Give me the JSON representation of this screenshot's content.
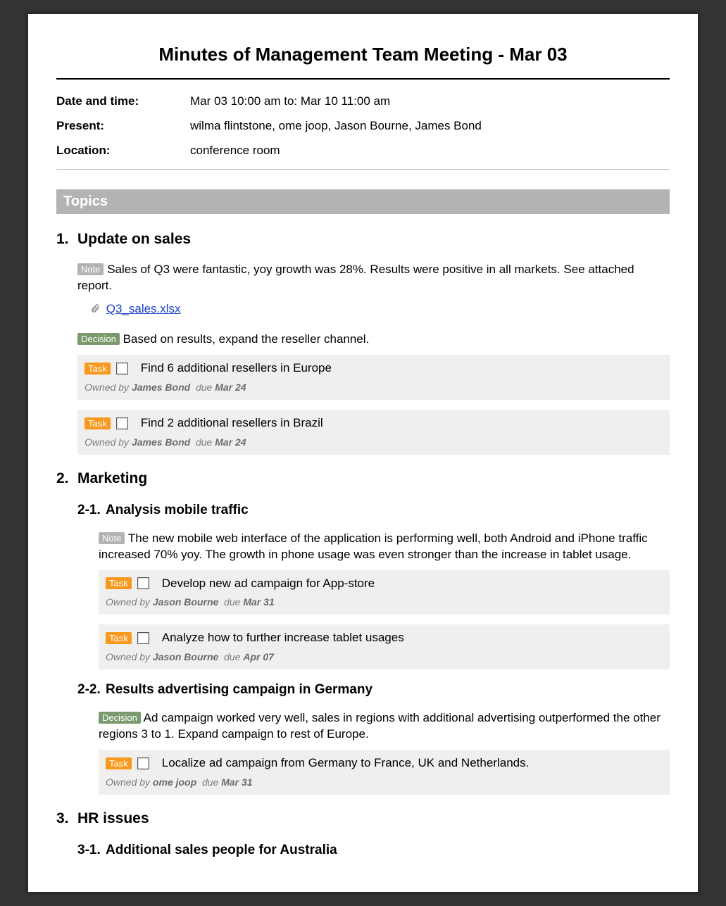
{
  "title": "Minutes of Management Team Meeting - Mar 03",
  "meta": {
    "date_label": "Date and time:",
    "date_value": "Mar 03 10:00 am to: Mar 10 11:00 am",
    "present_label": "Present:",
    "present_value": "wilma flintstone, ome joop, Jason Bourne, James Bond",
    "location_label": "Location:",
    "location_value": "conference room"
  },
  "section_heading": "Topics",
  "labels": {
    "note": "Note",
    "decision": "Decision",
    "task": "Task",
    "owned_by": "Owned by ",
    "due": "due "
  },
  "topics": {
    "t1": {
      "num": "1.",
      "title": "Update on sales",
      "note": "Sales of Q3 were fantastic, yoy growth was 28%. Results were positive in all markets. See attached report.",
      "attachment": "Q3_sales.xlsx",
      "decision": "Based on results, expand the reseller channel.",
      "task1": {
        "title": "Find 6 additional resellers in Europe",
        "owner": "James Bond",
        "due": "Mar 24"
      },
      "task2": {
        "title": "Find 2 additional resellers in Brazil",
        "owner": "James Bond",
        "due": "Mar 24"
      }
    },
    "t2": {
      "num": "2.",
      "title": "Marketing",
      "s1": {
        "num": "2-1.",
        "title": "Analysis mobile traffic",
        "note": "The new mobile web interface of the application is performing well, both Android and iPhone traffic increased 70% yoy. The growth in phone usage was even stronger than the increase in tablet usage.",
        "task1": {
          "title": "Develop new ad campaign for App-store",
          "owner": "Jason Bourne",
          "due": "Mar 31"
        },
        "task2": {
          "title": "Analyze how to further increase tablet usages",
          "owner": "Jason Bourne",
          "due": "Apr 07"
        }
      },
      "s2": {
        "num": "2-2.",
        "title": "Results advertising campaign in Germany",
        "decision": "Ad campaign worked very well, sales in regions with additional advertising outperformed the other regions 3 to 1. Expand campaign to rest of Europe.",
        "task1": {
          "title": "Localize ad campaign from Germany to France, UK and Netherlands.",
          "owner": "ome joop",
          "due": "Mar 31"
        }
      }
    },
    "t3": {
      "num": "3.",
      "title": "HR issues",
      "s1": {
        "num": "3-1.",
        "title": "Additional sales people for Australia"
      }
    }
  }
}
